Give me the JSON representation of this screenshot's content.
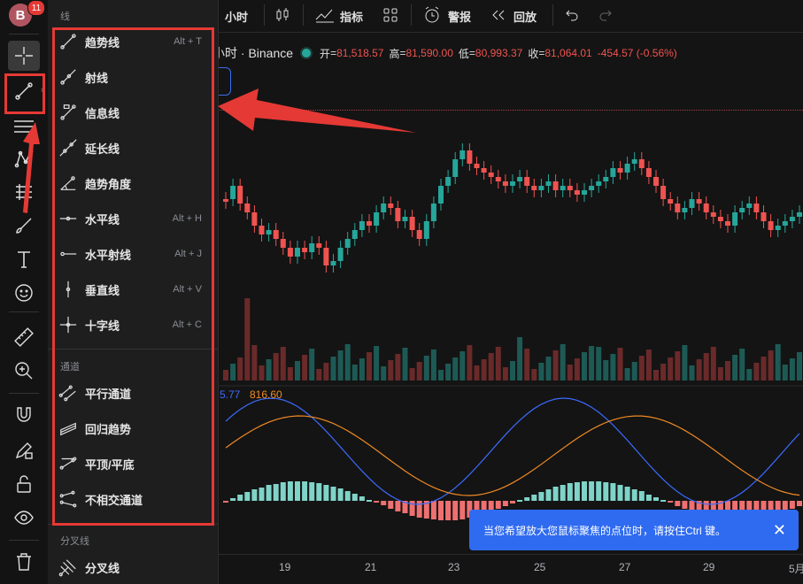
{
  "avatar": {
    "letter": "B",
    "badge": "11"
  },
  "topbar": {
    "interval": "小时",
    "indicators": "指标",
    "alert": "警报",
    "replay": "回放"
  },
  "legend": {
    "symbol": "小时 · Binance",
    "open_label": "开",
    "open": "81,518.57",
    "high_label": "高",
    "high": "81,590.00",
    "low_label": "低",
    "low": "80,993.37",
    "close_label": "收",
    "close": "81,064.01",
    "change": "-454.57 (-0.56%)"
  },
  "macd": {
    "v1": "5.77",
    "v2": "816.60"
  },
  "menu": {
    "sections": {
      "lines": "线",
      "channels": "通道",
      "pitchforks": "分叉线"
    },
    "lines": [
      {
        "label": "趋势线",
        "shortcut": "Alt + T",
        "icon": "trend-line-icon"
      },
      {
        "label": "射线",
        "shortcut": "",
        "icon": "ray-icon"
      },
      {
        "label": "信息线",
        "shortcut": "",
        "icon": "info-line-icon"
      },
      {
        "label": "延长线",
        "shortcut": "",
        "icon": "extended-line-icon"
      },
      {
        "label": "趋势角度",
        "shortcut": "",
        "icon": "trend-angle-icon"
      },
      {
        "label": "水平线",
        "shortcut": "Alt + H",
        "icon": "horizontal-line-icon"
      },
      {
        "label": "水平射线",
        "shortcut": "Alt + J",
        "icon": "horizontal-ray-icon"
      },
      {
        "label": "垂直线",
        "shortcut": "Alt + V",
        "icon": "vertical-line-icon"
      },
      {
        "label": "十字线",
        "shortcut": "Alt + C",
        "icon": "cross-line-icon"
      }
    ],
    "channels": [
      {
        "label": "平行通道",
        "icon": "parallel-channel-icon"
      },
      {
        "label": "回归趋势",
        "icon": "regression-trend-icon"
      },
      {
        "label": "平顶/平底",
        "icon": "flat-top-bottom-icon"
      },
      {
        "label": "不相交通道",
        "icon": "disjoint-channel-icon"
      }
    ],
    "pitchforks": [
      {
        "label": "分叉线",
        "icon": "pitchfork-icon"
      }
    ]
  },
  "xaxis": [
    "19",
    "21",
    "23",
    "25",
    "27",
    "29",
    "5月"
  ],
  "toast": {
    "text": "当您希望放大您鼠标聚焦的点位时，请按住Ctrl 键。"
  },
  "colors": {
    "up": "#26a69a",
    "down": "#ef5350",
    "accent": "#2f6bf1",
    "annotation": "#e53935"
  }
}
